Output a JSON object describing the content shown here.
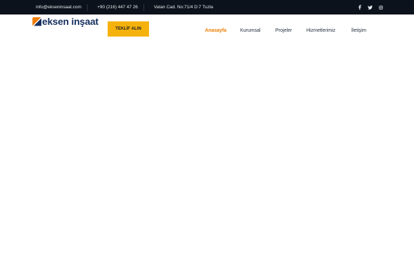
{
  "topbar": {
    "email": "info@ekseninsaat.com",
    "phone": "+90 (216) 447 47 26",
    "address": "Vatan Cad. No:71/4 D:7 Tuzla",
    "social": [
      "facebook-icon",
      "twitter-icon",
      "instagram-icon"
    ]
  },
  "brand": {
    "name": "eksen inşaat",
    "colors": {
      "primary": "#16305f",
      "accent": "#ef7d00"
    }
  },
  "cta": {
    "label": "TEKLİF ALIN"
  },
  "nav": {
    "items": [
      "Anasayfa",
      "Kurumsal",
      "Projeler",
      "Hizmetlerimiz",
      "İletişim"
    ],
    "active": "Anasayfa"
  },
  "colors": {
    "topbar_bg": "#0b121b",
    "cta_bg": "#f5b20d",
    "nav_active": "#ef7d00"
  }
}
